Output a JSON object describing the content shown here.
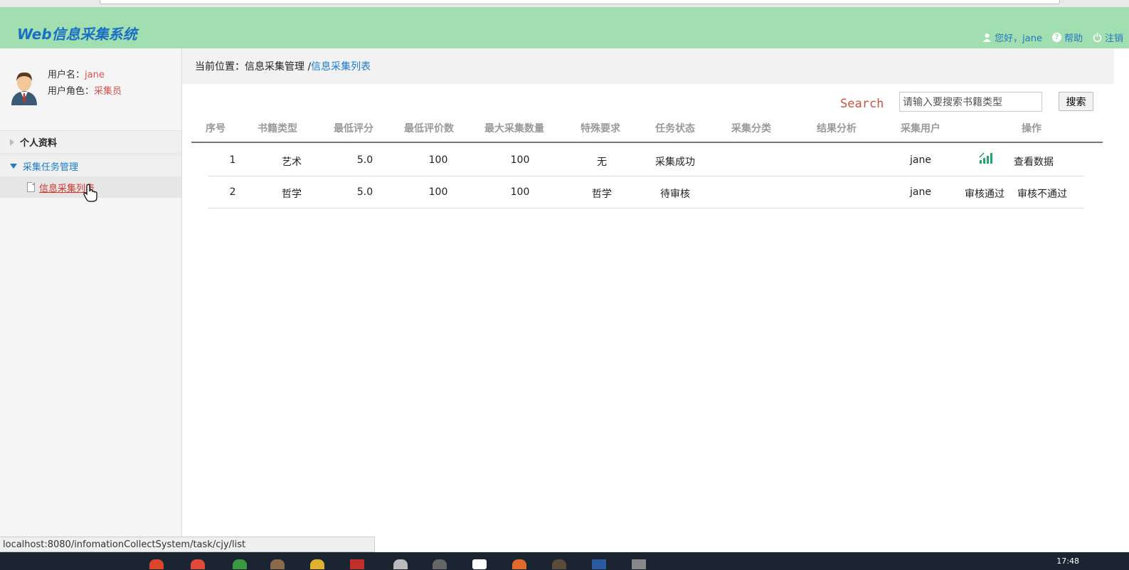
{
  "header": {
    "logo": "Web信息采集系统",
    "greeting": "您好，jane",
    "help": "帮助",
    "logout": "注销"
  },
  "sidebar": {
    "username_label": "用户名：",
    "username": "jane",
    "role_label": "用户角色：",
    "role": "采集员",
    "menu": [
      {
        "label": "个人资料"
      },
      {
        "label": "采集任务管理"
      }
    ],
    "sub_item": "信息采集列表"
  },
  "breadcrumb": {
    "prefix": "当前位置：信息采集管理 / ",
    "current": "信息采集列表"
  },
  "search": {
    "label": "Search",
    "placeholder": "请输入要搜索书籍类型",
    "button": "搜索"
  },
  "table": {
    "headers": [
      "序号",
      "书籍类型",
      "最低评分",
      "最低评价数",
      "最大采集数量",
      "特殊要求",
      "任务状态",
      "采集分类",
      "结果分析",
      "采集用户",
      "操作"
    ],
    "rows": [
      {
        "no": "1",
        "type": "艺术",
        "min_score": "5.0",
        "min_reviews": "100",
        "max_count": "100",
        "special": "无",
        "status": "采集成功",
        "category": "",
        "analysis": "",
        "user": "jane",
        "action1_icon": "bar-chart-icon",
        "action2": "查看数据"
      },
      {
        "no": "2",
        "type": "哲学",
        "min_score": "5.0",
        "min_reviews": "100",
        "max_count": "100",
        "special": "哲学",
        "status": "待审核",
        "category": "",
        "analysis": "",
        "user": "jane",
        "action1": "审核通过",
        "action2": "审核不通过"
      }
    ]
  },
  "statusbar": {
    "url": "localhost:8080/infomationCollectSystem/task/cjy/list"
  },
  "taskbar": {
    "clock": "17:48"
  },
  "colors": {
    "header_bg": "#a1dfb1",
    "link": "#1a7bd3",
    "accent_red": "#d9362b"
  }
}
